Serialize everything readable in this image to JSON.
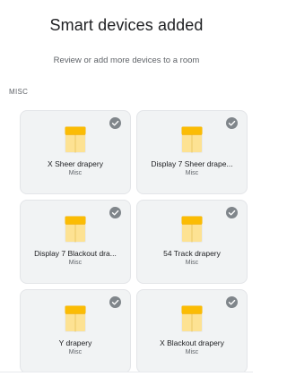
{
  "header": {
    "title": "Smart devices added",
    "subtitle": "Review or add more devices to a room"
  },
  "section": {
    "label": "MISC"
  },
  "devices": [
    {
      "name": "X Sheer drapery",
      "room": "Misc",
      "icon": "curtain-icon",
      "selected": true
    },
    {
      "name": "Display 7 Sheer drape...",
      "room": "Misc",
      "icon": "curtain-icon",
      "selected": true
    },
    {
      "name": "Display 7 Blackout dra...",
      "room": "Misc",
      "icon": "curtain-icon",
      "selected": true
    },
    {
      "name": "54 Track drapery",
      "room": "Misc",
      "icon": "curtain-icon",
      "selected": true
    },
    {
      "name": "Y drapery",
      "room": "Misc",
      "icon": "curtain-icon",
      "selected": true
    },
    {
      "name": "X Blackout drapery",
      "room": "Misc",
      "icon": "curtain-icon",
      "selected": true
    }
  ],
  "colors": {
    "curtain_top": "#fbbc04",
    "curtain_body": "#fde293",
    "check_bg": "#80868b",
    "card_bg": "#f1f3f4"
  }
}
